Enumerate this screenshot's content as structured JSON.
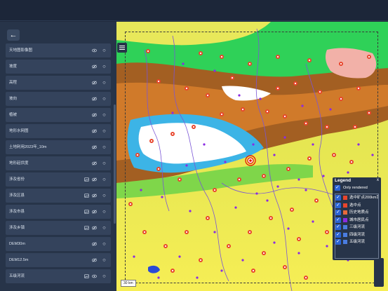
{
  "header": {
    "title": ""
  },
  "sidebar": {
    "back_label": "←",
    "layers": [
      {
        "label": "天地图影像图",
        "icons": [
          "eye-icon",
          "pin-icon"
        ]
      },
      {
        "label": "坡度",
        "icons": [
          "eye-slash-icon",
          "pin-icon"
        ]
      },
      {
        "label": "高程",
        "icons": [
          "eye-slash-icon",
          "pin-icon"
        ]
      },
      {
        "label": "坡向",
        "icons": [
          "eye-slash-icon",
          "pin-icon"
        ]
      },
      {
        "label": "植被",
        "icons": [
          "eye-slash-icon",
          "pin-icon"
        ]
      },
      {
        "label": "地形水网图",
        "icons": [
          "eye-slash-icon",
          "pin-icon"
        ]
      },
      {
        "label": "土地利用2023年_10m",
        "icons": [
          "eye-slash-icon",
          "pin-icon"
        ]
      },
      {
        "label": "地形起伏度",
        "icons": [
          "eye-slash-icon",
          "pin-icon"
        ]
      },
      {
        "label": "涉及省份",
        "icons": [
          "image-icon",
          "eye-slash-icon",
          "pin-icon"
        ]
      },
      {
        "label": "涉及区县",
        "icons": [
          "image-icon",
          "eye-slash-icon",
          "pin-icon"
        ]
      },
      {
        "label": "涉及市县",
        "icons": [
          "image-icon",
          "eye-slash-icon",
          "pin-icon"
        ]
      },
      {
        "label": "涉及乡镇",
        "icons": [
          "image-icon",
          "eye-slash-icon",
          "pin-icon"
        ]
      },
      {
        "label": "DEM30m",
        "icons": [
          "eye-slash-icon",
          "pin-icon"
        ]
      },
      {
        "label": "DEM12.5m",
        "icons": [
          "eye-slash-icon",
          "pin-icon"
        ]
      },
      {
        "label": "五级河流",
        "icons": [
          "image-icon",
          "eye-icon",
          "pin-icon"
        ]
      }
    ]
  },
  "map": {
    "scale_label": "30 km",
    "legend": {
      "title": "Legend",
      "close": "x",
      "only_rendered_label": "Only rendered",
      "items": [
        {
          "label": "选中矿点200km范围",
          "swatch": "#e8452c"
        },
        {
          "label": "选中点",
          "swatch": "#e8452c"
        },
        {
          "label": "历史地质点",
          "swatch": "#e86a3c"
        },
        {
          "label": "城市居民点",
          "swatch": "#8a2be2"
        },
        {
          "label": "三级河流",
          "swatch": "#4a7de0"
        },
        {
          "label": "四级河流",
          "swatch": "#4a7de0"
        },
        {
          "label": "五级河流",
          "swatch": "#4a7de0"
        }
      ]
    },
    "colors": {
      "lowland": "#f0ec5a",
      "green_zone": "#2fd158",
      "highland": "#a35f22",
      "snow": "#ffffff",
      "glacier": "#3cb4e6",
      "river": "#7a55d6",
      "town_marker": "#e8452c",
      "city_point": "#8a2be2",
      "selected_point": "#e80000"
    }
  }
}
